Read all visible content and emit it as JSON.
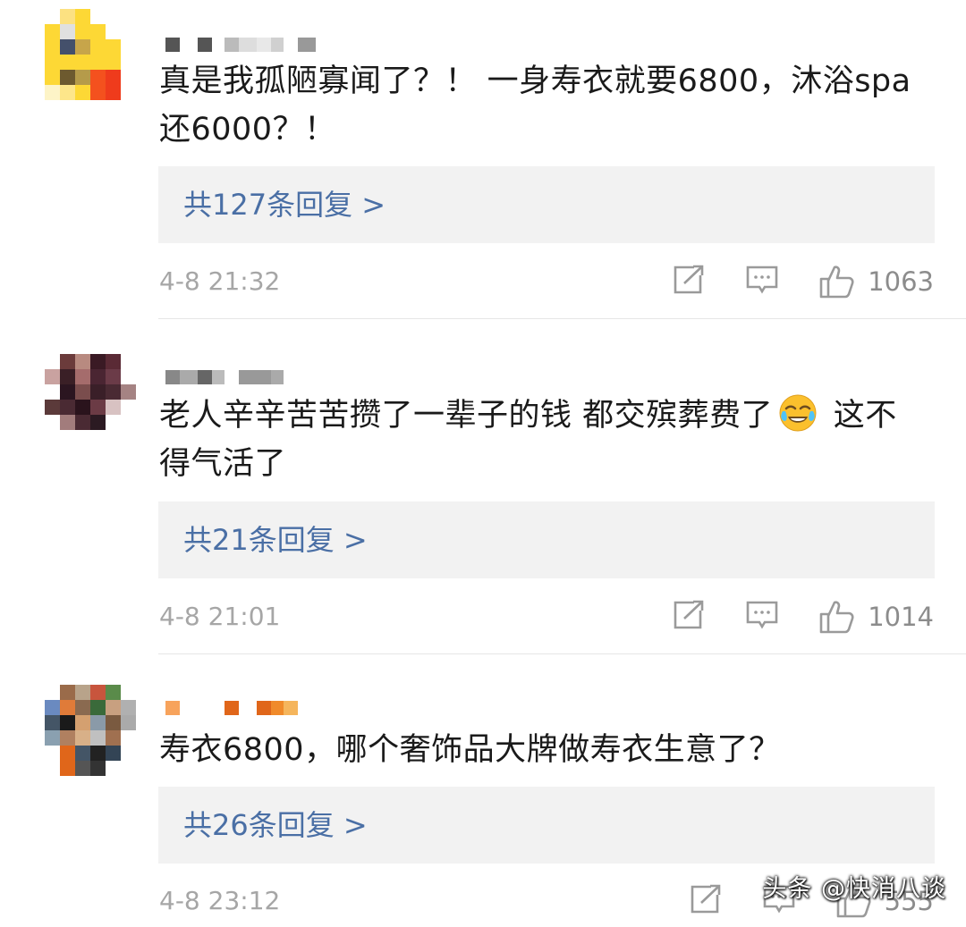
{
  "comments": [
    {
      "text": "真是我孤陋寡闻了？！ 一身寿衣就要6800，沐浴spa还6000？！",
      "replies": "共127条回复 >",
      "time": "4-8 21:32",
      "likes": "1063",
      "avatar_colors": [
        "#ffffff",
        "#fce181",
        "#fdd835",
        "#ffffff",
        "#ffffff",
        "#ffffff",
        "#fdd835",
        "#e0e0e0",
        "#fdd835",
        "#fdd835",
        "#ffffff",
        "#ffffff",
        "#fdd835",
        "#44506b",
        "#c7a54a",
        "#fdd835",
        "#fdd835",
        "#ffffff",
        "#fdd835",
        "#fdd835",
        "#fdd835",
        "#fdd835",
        "#fdd835",
        "#ffffff",
        "#fdd835",
        "#6d5a2f",
        "#b59b4a",
        "#f4511e",
        "#ef3b1c",
        "#ffffff",
        "#fdf4c7",
        "#fde68a",
        "#fdd835",
        "#f4511e",
        "#ef3b1c",
        "#ffffff"
      ],
      "name_colors": [
        "#555555",
        "#ffffff",
        "#555555",
        "#ffffff",
        "#bbbbbb",
        "#dddddd",
        "#e8e8e8",
        "#d0d0d0",
        "#ffffff",
        "#999999"
      ]
    },
    {
      "text_before_emoji": "老人辛辛苦苦攒了一辈子的钱 都交殡葬费了",
      "text_after_emoji": " 这不得气活了",
      "emoji_name": "crying-laughing-emoji",
      "replies": "共21条回复 >",
      "time": "4-8 21:01",
      "likes": "1014",
      "avatar_colors": [
        "#ffffff",
        "#6b3b3b",
        "#b88a80",
        "#3a1a24",
        "#5a2a35",
        "#ffffff",
        "#c9a2a0",
        "#3a1f26",
        "#a56c6c",
        "#4a2532",
        "#6b3b48",
        "#ffffff",
        "#ffffff",
        "#2b1520",
        "#7a4d4d",
        "#3a1f28",
        "#4a2a33",
        "#a58383",
        "#5b3a3a",
        "#4a2a33",
        "#2a131c",
        "#6b3b45",
        "#d8c2c2",
        "#ffffff",
        "#ffffff",
        "#a27c7c",
        "#4a2a33",
        "#2b1a22",
        "#ffffff",
        "#ffffff",
        "#ffffff",
        "#ffffff",
        "#ffffff",
        "#ffffff",
        "#ffffff",
        "#ffffff"
      ],
      "name_colors": [
        "#888888",
        "#aaaaaa",
        "#666666",
        "#bbbbbb",
        "#ffffff",
        "#999999",
        "#999999",
        "#aaaaaa"
      ]
    },
    {
      "text": "寿衣6800，哪个奢饰品大牌做寿衣生意了？",
      "replies": "共26条回复 >",
      "time": "4-8 23:12",
      "likes": "555",
      "avatar_colors": [
        "#ffffff",
        "#9a6b4a",
        "#b8a38a",
        "#c8553d",
        "#5a8b4a",
        "#ffffff",
        "#6a8ac0",
        "#e07b39",
        "#8a6a50",
        "#3a6a3a",
        "#c8a080",
        "#b0b0b0",
        "#445566",
        "#1a1a1a",
        "#d4a070",
        "#8a9aa8",
        "#7a5a40",
        "#aaaaaa",
        "#8aa0b0",
        "#b08060",
        "#d8b088",
        "#c0c0c0",
        "#a07050",
        "#ffffff",
        "#ffffff",
        "#e0661a",
        "#445566",
        "#222222",
        "#334455",
        "#ffffff",
        "#ffffff",
        "#e0661a",
        "#555555",
        "#333333",
        "#ffffff",
        "#ffffff"
      ],
      "name_colors": [
        "#f7a35c",
        "#ffffff",
        "#ffffff",
        "#ffffff",
        "#e0661a",
        "#ffffff",
        "#e0661a",
        "#f08a2a",
        "#f5b55c"
      ]
    }
  ],
  "watermark": "头条 @快消八谈",
  "colors": {
    "reply_link": "#4a6fa5",
    "reply_bg": "#f2f2f2",
    "meta_text": "#a6a6a6"
  }
}
